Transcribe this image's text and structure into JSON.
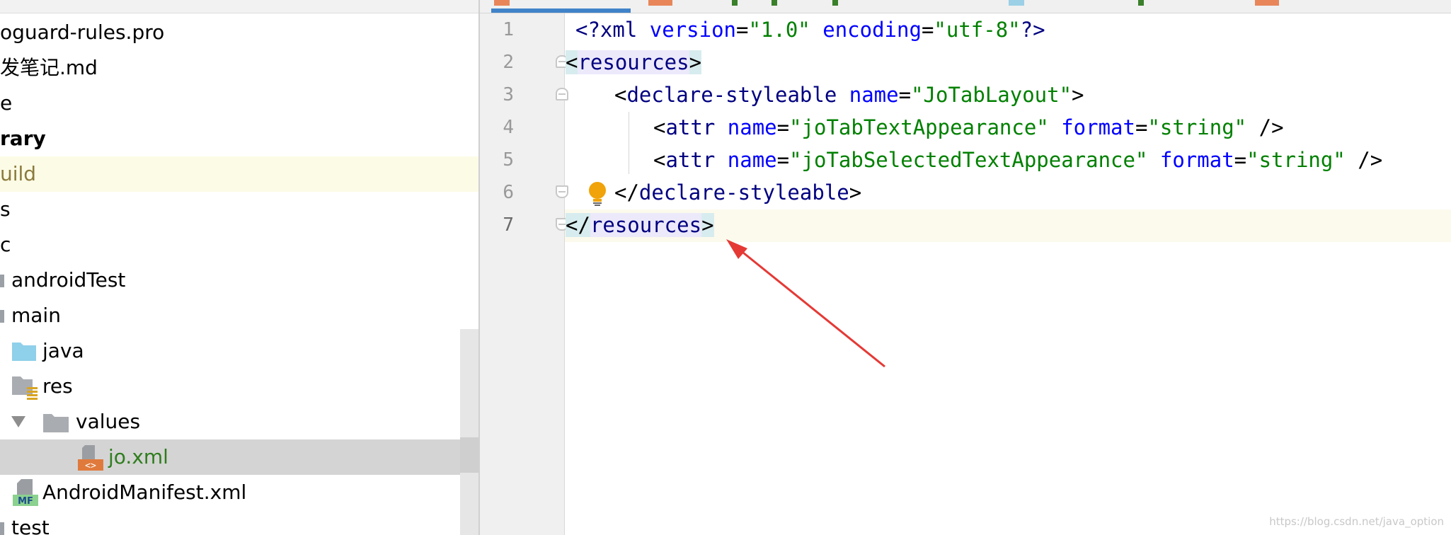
{
  "project_tree": {
    "rows": [
      {
        "label": "oguard-rules.pro"
      },
      {
        "label": "发笔记.md"
      },
      {
        "label": "e"
      },
      {
        "label": "rary"
      },
      {
        "label": "uild"
      },
      {
        "label": "s"
      },
      {
        "label": "c"
      },
      {
        "label": "androidTest"
      },
      {
        "label": "main"
      },
      {
        "label": "java"
      },
      {
        "label": "res"
      },
      {
        "label": "values"
      },
      {
        "label": "jo.xml"
      },
      {
        "label": "AndroidManifest.xml"
      },
      {
        "label": "test"
      }
    ],
    "manifest_badge": "MF"
  },
  "editor": {
    "line_numbers": [
      "1",
      "2",
      "3",
      "4",
      "5",
      "6",
      "7"
    ],
    "code": {
      "l1": {
        "open": "<?",
        "name": "xml",
        "a1": "version",
        "eq1": "=",
        "v1": "\"1.0\"",
        "a2": "encoding",
        "eq2": "=",
        "v2": "\"utf-8\"",
        "close": "?>"
      },
      "l2": {
        "lt": "<",
        "name": "resources",
        "gt": ">"
      },
      "l3": {
        "lt": "<",
        "name": "declare-styleable",
        "a1": "name",
        "eq1": "=",
        "v1": "\"JoTabLayout\"",
        "gt": ">"
      },
      "l4": {
        "lt": "<",
        "name": "attr",
        "a1": "name",
        "eq1": "=",
        "v1": "\"joTabTextAppearance\"",
        "a2": "format",
        "eq2": "=",
        "v2": "\"string\"",
        "end": "/>"
      },
      "l5": {
        "lt": "<",
        "name": "attr",
        "a1": "name",
        "eq1": "=",
        "v1": "\"joTabSelectedTextAppearance\"",
        "a2": "format",
        "eq2": "=",
        "v2": "\"string\"",
        "end": "/>"
      },
      "l6": {
        "lt": "</",
        "name": "declare-styleable",
        "gt": ">"
      },
      "l7": {
        "lt": "</",
        "name": "resources",
        "gt": ">"
      }
    }
  },
  "watermark": "https://blog.csdn.net/java_option",
  "colors": {
    "xml_tag": "#000080",
    "xml_attr": "#0000ff",
    "xml_value": "#008000",
    "active_tab": "#4083c9",
    "annotation_arrow": "#e53935",
    "selected_file": "#2f7d1e"
  },
  "icons": {
    "bulb": "lightbulb-icon",
    "folder": "folder-icon",
    "xml_file": "xml-file-icon",
    "manifest_file": "manifest-file-icon",
    "res_folder": "resource-folder-icon",
    "expand": "triangle-down-icon"
  }
}
